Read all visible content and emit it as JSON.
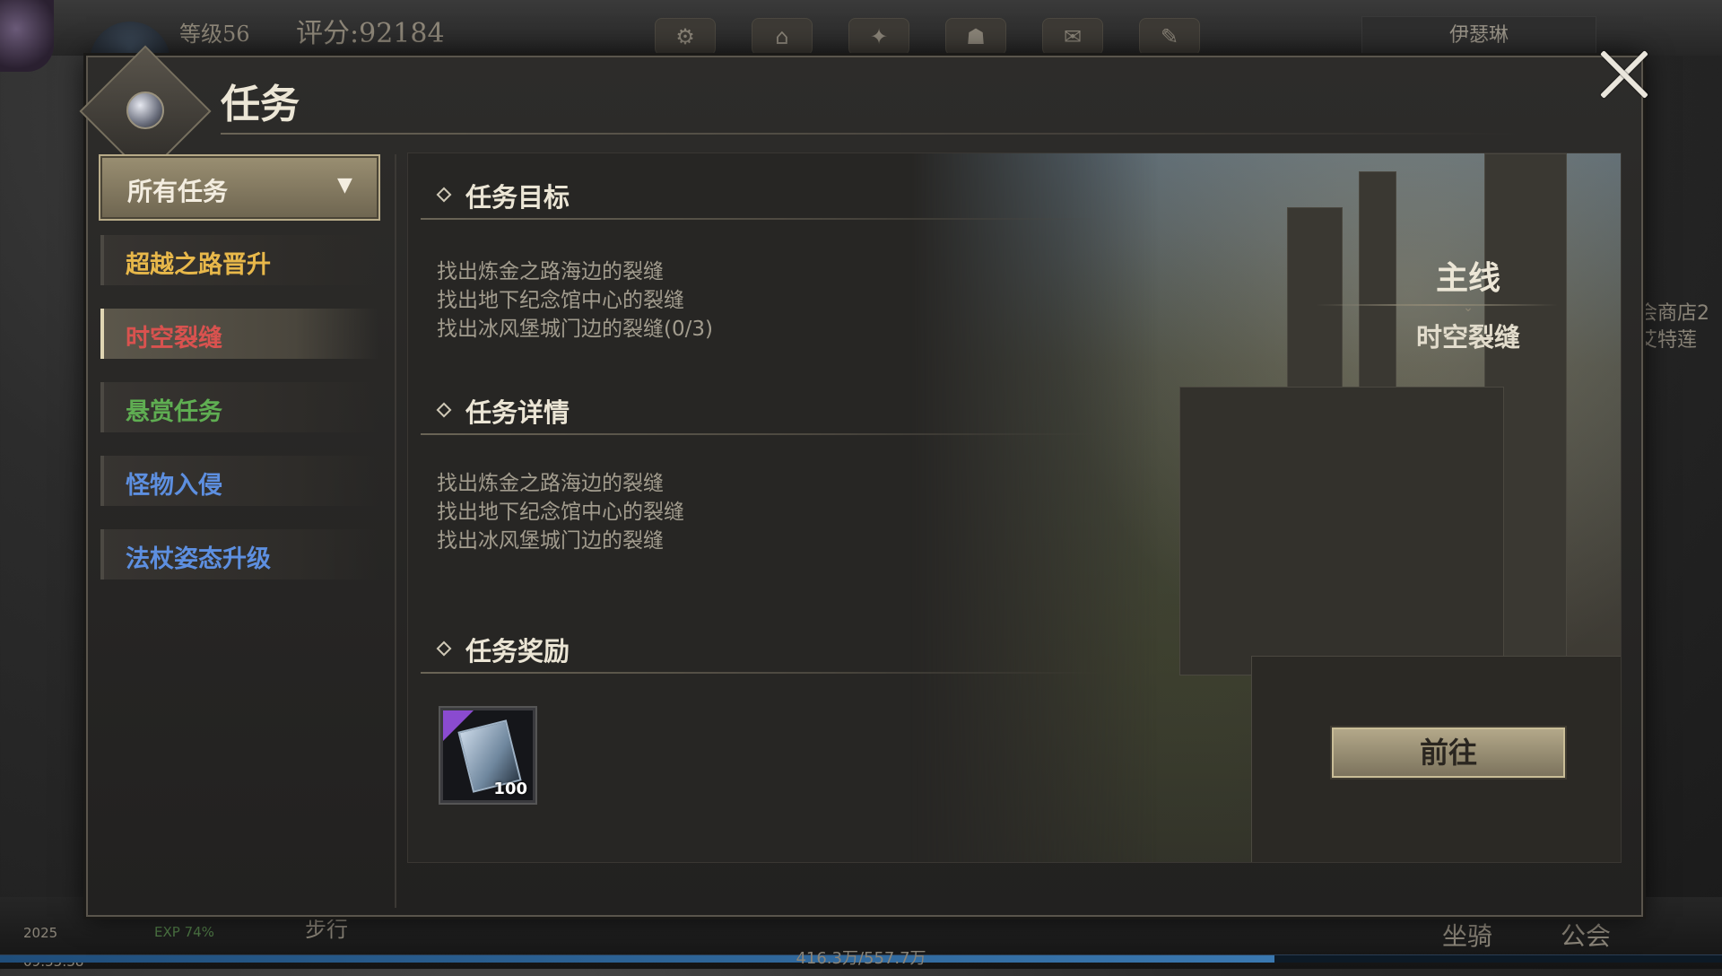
{
  "hud": {
    "level": "等级56",
    "score": "评分:92184",
    "character_name": "伊瑟琳",
    "right_side_text": [
      "会商店2",
      "艾特莲"
    ],
    "clock": "09:55:38",
    "date_fragment": "2025",
    "exp": "EXP 74%",
    "walk": "步行",
    "mount": "坐骑",
    "guild": "公会",
    "hp_text": "416.3万/557.7万",
    "exp_bar_fraction": 0.74
  },
  "window": {
    "title": "任务",
    "close_icon": "close-icon"
  },
  "sidebar": {
    "filter_label": "所有任务",
    "items": [
      {
        "label": "超越之路晋升",
        "color": "#e8b84a"
      },
      {
        "label": "时空裂缝",
        "color": "#d9524f",
        "active": true
      },
      {
        "label": "悬赏任务",
        "color": "#5fae52"
      },
      {
        "label": "怪物入侵",
        "color": "#5d8fe0"
      },
      {
        "label": "法杖姿态升级",
        "color": "#5d8fe0"
      }
    ]
  },
  "quest": {
    "objective_heading": "任务目标",
    "objectives": [
      "找出炼金之路海边的裂缝",
      "找出地下纪念馆中心的裂缝",
      "找出冰风堡城门边的裂缝(0/3)"
    ],
    "details_heading": "任务详情",
    "details": [
      "找出炼金之路海边的裂缝",
      "找出地下纪念馆中心的裂缝",
      "找出冰风堡城门边的裂缝"
    ],
    "reward_heading": "任务奖励",
    "reward_quantity": "100",
    "reward_rarity_color": "#8a4bd0",
    "category": "主线",
    "quest_name": "时空裂缝",
    "go_button": "前往"
  }
}
